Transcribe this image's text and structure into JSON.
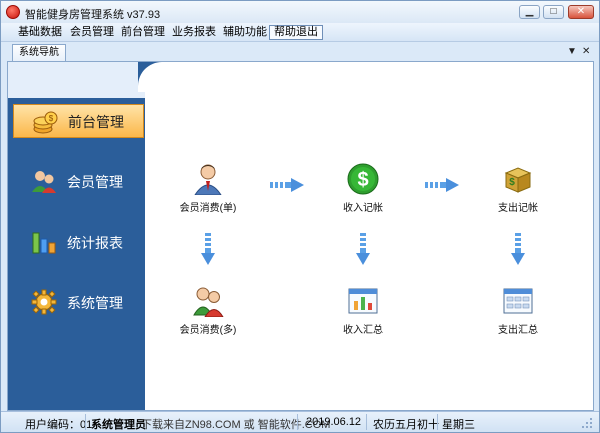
{
  "window": {
    "title": "智能健身房管理系统 v37.93"
  },
  "menu": {
    "items": [
      "基础数据",
      "会员管理",
      "前台管理",
      "业务报表",
      "辅助功能",
      "帮助退出"
    ]
  },
  "panel": {
    "tab_label": "系统导航"
  },
  "sidebar": {
    "items": [
      {
        "label": "前台管理",
        "icon": "coins-icon",
        "active": true
      },
      {
        "label": "会员管理",
        "icon": "members-icon",
        "active": false
      },
      {
        "label": "统计报表",
        "icon": "bar-chart-icon",
        "active": false
      },
      {
        "label": "系统管理",
        "icon": "gear-icon",
        "active": false
      }
    ]
  },
  "flow": {
    "nodes": [
      {
        "label": "会员消费(单)",
        "icon": "member-single-icon"
      },
      {
        "label": "收入记帐",
        "icon": "dollar-icon"
      },
      {
        "label": "支出记帐",
        "icon": "money-box-icon"
      },
      {
        "label": "会员消费(多)",
        "icon": "members-multi-icon"
      },
      {
        "label": "收入汇总",
        "icon": "income-summary-icon"
      },
      {
        "label": "支出汇总",
        "icon": "expense-summary-icon"
      }
    ]
  },
  "status": {
    "user_code": "用户编码：01",
    "operator": "系统管理员",
    "watermark": "下载来自ZN98.COM 或 智能软件.COM",
    "date": "2019.06.12",
    "lunar": "农历五月初十",
    "weekday": "星期三"
  },
  "colors": {
    "sidebar": "#2b5e9a",
    "active_nav": "#fbb74a",
    "frame": "#dbe9f8"
  }
}
